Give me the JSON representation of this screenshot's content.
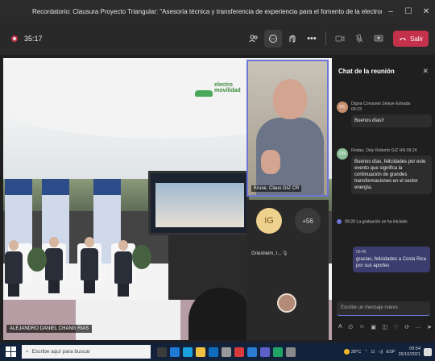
{
  "window": {
    "title": "Recordatorio: Clausura Proyecto Triangular: \"Asesoría técnica y transferencia de experiencia para el fomento de la electromovilidad en Honduras\" ...",
    "minimize": "–",
    "maximize": "☐",
    "close": "✕"
  },
  "toolbar": {
    "timer": "35:17",
    "leave_label": "Salir"
  },
  "stage": {
    "logo_text_1": "electro",
    "logo_text_2": "movilidad",
    "main_speaker_name": "ALEJANDRO DANIEL CHANG RIAS",
    "self_name": "Kruse, Claus GIZ CR"
  },
  "participants": {
    "ig_initials": "IG",
    "more_count": "+56",
    "ig_name": "Griesheim, I..."
  },
  "chat": {
    "title": "Chat de la reunión",
    "messages": [
      {
        "initials": "DC",
        "author": "Digna Consuelo Zelaye Estrada",
        "time": "09:23",
        "text": "Buenos días!!"
      },
      {
        "initials": "OR",
        "author": "Rodas, Osly Roberto GIZ HN",
        "time": "09:24",
        "text": "Buenos días, felicidades por este evento que significa la continuación de grandes transformaciones en el sector energía."
      }
    ],
    "system_message": "09:26  La grabación se ha iniciado",
    "own_message": {
      "time": "09:45",
      "text": "gracias, felicidades a Costa Rica por sus aportes"
    },
    "input_placeholder": "Escribe un mensaje nuevo"
  },
  "taskbar": {
    "search_placeholder": "Escribe aquí para buscar",
    "temperature": "28°C",
    "language": "ESP",
    "time": "09:54",
    "date": "26/10/2021"
  }
}
